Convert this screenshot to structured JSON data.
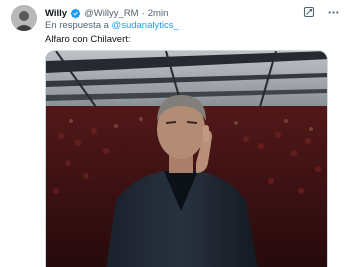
{
  "tweet": {
    "author_name": "Willy",
    "handle": "@Willyy_RM",
    "separator": "·",
    "time": "2min",
    "reply_prefix": "En respuesta a",
    "reply_to": "@sudanalytics_",
    "text": "Alfaro con Chilavert:"
  },
  "icons": {
    "verified": "verified-badge-icon",
    "grok": "grok-icon",
    "more": "more-options-icon"
  },
  "colors": {
    "accent": "#1d9bf0",
    "secondary_text": "#536471",
    "primary_text": "#0f1419"
  },
  "media": {
    "type": "video-still"
  }
}
